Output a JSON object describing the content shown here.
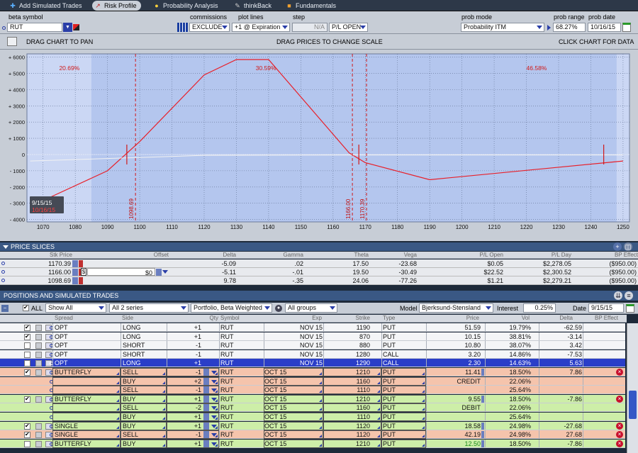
{
  "tabs": [
    {
      "label": "Add Simulated Trades",
      "icon": "plus-icon"
    },
    {
      "label": "Risk Profile",
      "icon": "chart-icon"
    },
    {
      "label": "Probability Analysis",
      "icon": "bulb-icon"
    },
    {
      "label": "thinkBack",
      "icon": "thinkback-icon"
    },
    {
      "label": "Fundamentals",
      "icon": "fundamentals-icon"
    }
  ],
  "controls": {
    "beta_symbol_label": "beta symbol",
    "symbol": "RUT",
    "commissions_label": "commissions",
    "commissions_value": "EXCLUDE",
    "plot_lines_label": "plot lines",
    "plot_lines_value": "+1 @ Expiration",
    "step_label": "step",
    "step_value": "N/A",
    "pl_mode": "P/L OPEN",
    "prob_mode_label": "prob mode",
    "prob_mode_value": "Probability ITM",
    "prob_range_label": "prob range",
    "prob_range_value": "68.27%",
    "prob_date_label": "prob date",
    "prob_date_value": "10/16/15"
  },
  "hints": {
    "pan": "DRAG CHART TO PAN",
    "scale": "DRAG PRICES TO CHANGE SCALE",
    "data": "CLICK CHART FOR DATA"
  },
  "chart_data": {
    "type": "line",
    "title": "",
    "xlabel": "",
    "ylabel": "",
    "xlim": [
      1065,
      1252
    ],
    "ylim": [
      -4150,
      6200
    ],
    "x_ticks": [
      "1070",
      "1080",
      "1090",
      "1100",
      "1110",
      "1120",
      "1130",
      "1140",
      "1150",
      "1160",
      "1170",
      "1180",
      "1190",
      "1200",
      "1210",
      "1220",
      "1230",
      "1240",
      "1250"
    ],
    "y_ticks": [
      "+ 6000",
      "+ 5000",
      "+ 4000",
      "+ 3000",
      "+ 2000",
      "+ 1000",
      "0",
      "- 1000",
      "- 2000",
      "- 3000",
      "- 4000"
    ],
    "series": [
      {
        "color": "#e8202a",
        "x": [
          1066,
          1090,
          1100,
          1120,
          1130,
          1140,
          1165,
          1170,
          1190,
          1250
        ],
        "y": [
          -3200,
          -1000,
          800,
          4900,
          5850,
          5850,
          100,
          -500,
          -1550,
          -400
        ]
      },
      {
        "color": "#f2f2f2",
        "x": [
          1066,
          1120,
          1170,
          1250
        ],
        "y": [
          -400,
          -50,
          -30,
          -30
        ]
      }
    ],
    "vlines": [
      {
        "x": 1098.69,
        "label": "1098.69"
      },
      {
        "x": 1166.0,
        "label": "1166.00"
      },
      {
        "x": 1170.39,
        "label": "1170.39"
      }
    ],
    "prob_labels": [
      {
        "x": 1075,
        "label": "20.69%"
      },
      {
        "x": 1136,
        "label": "30.59%"
      },
      {
        "x": 1220,
        "label": "46.58%"
      }
    ],
    "date_marker": {
      "date": "9/15/15",
      "date2": "10/16/15"
    },
    "background_color": "#b4c6ee",
    "band_color": "#d4def6"
  },
  "price_slices": {
    "title": "PRICE SLICES",
    "headers": [
      "Stk Price",
      "Offset",
      "Delta",
      "Gamma",
      "Theta",
      "Vega",
      "P/L Open",
      "P/L Day",
      "BP Effect"
    ],
    "rows": [
      {
        "price": "1170.39",
        "offset": "",
        "delta": "-5.09",
        "gamma": ".02",
        "theta": "17.50",
        "vega": "-23.68",
        "pl_open": "$0.05",
        "pl_day": "$2,278.05",
        "bp": "($950.00)"
      },
      {
        "price": "1166.00",
        "offset": "$0",
        "delta": "-5.11",
        "gamma": "-.01",
        "theta": "19.50",
        "vega": "-30.49",
        "pl_open": "$22.52",
        "pl_day": "$2,300.52",
        "bp": "($950.00)"
      },
      {
        "price": "1098.69",
        "offset": "",
        "delta": "9.78",
        "gamma": "-.35",
        "theta": "24.06",
        "vega": "-77.26",
        "pl_open": "$1.21",
        "pl_day": "$2,279.21",
        "bp": "($950.00)"
      }
    ]
  },
  "positions": {
    "title": "POSITIONS AND SIMULATED TRADES",
    "all_label": "ALL",
    "filter": "Show All",
    "series_filter": "All 2 series",
    "portfolio": "Portfolio, Beta Weighted",
    "groups": "All groups",
    "model_label": "Model",
    "model": "Bjerksund-Stensland",
    "interest_label": "Interest",
    "interest": "0.25%",
    "date_label": "Date",
    "date": "9/15/15",
    "headers": [
      "Spread",
      "Side",
      "Qty",
      "Symbol",
      "Exp",
      "Strike",
      "Type",
      "Price",
      "Vol",
      "Delta",
      "BP Effect"
    ],
    "rows": [
      {
        "k": "o",
        "on": true,
        "spread": "OPT",
        "side": "LONG",
        "qty": "+1",
        "sym": "RUT",
        "exp": "NOV 15",
        "strike": "1190",
        "type": "PUT",
        "price": "51.59",
        "vol": "19.79%",
        "delta": "-62.59"
      },
      {
        "k": "o",
        "on": true,
        "spread": "OPT",
        "side": "LONG",
        "qty": "+1",
        "sym": "RUT",
        "exp": "NOV 15",
        "strike": "870",
        "type": "PUT",
        "price": "10.15",
        "vol": "38.81%",
        "delta": "-3.14"
      },
      {
        "k": "o",
        "on": false,
        "spread": "OPT",
        "side": "SHORT",
        "qty": "-1",
        "sym": "RUT",
        "exp": "NOV 15",
        "strike": "880",
        "type": "PUT",
        "price": "10.80",
        "vol": "38.07%",
        "delta": "3.42"
      },
      {
        "k": "o",
        "on": false,
        "spread": "OPT",
        "side": "SHORT",
        "qty": "-1",
        "sym": "RUT",
        "exp": "NOV 15",
        "strike": "1280",
        "type": "CALL",
        "price": "3.20",
        "vol": "14.86%",
        "delta": "-7.53"
      },
      {
        "k": "s",
        "on": false,
        "spread": "OPT",
        "side": "LONG",
        "qty": "+1",
        "sym": "RUT",
        "exp": "NOV 15",
        "strike": "1290",
        "type": "CALL",
        "price": "2.30",
        "vol": "14.63%",
        "delta": "5.63"
      },
      {
        "k": "r",
        "on": true,
        "spread": "BUTTERFLY",
        "side": "SELL",
        "qty": "-1",
        "sym": "RUT",
        "exp": "OCT 15",
        "strike": "1210",
        "type": "PUT",
        "price": "11.41",
        "vol": "18.50%",
        "delta": "7.86",
        "del": true
      },
      {
        "k": "r",
        "on": null,
        "spread": "",
        "side": "BUY",
        "qty": "+2",
        "sym": "RUT",
        "exp": "OCT 15",
        "strike": "1160",
        "type": "PUT",
        "price": "CREDIT",
        "vol": "22.06%",
        "delta": ""
      },
      {
        "k": "r",
        "on": null,
        "spread": "",
        "side": "SELL",
        "qty": "-1",
        "sym": "RUT",
        "exp": "OCT 15",
        "strike": "1110",
        "type": "PUT",
        "price": "",
        "vol": "25.64%",
        "delta": ""
      },
      {
        "k": "g",
        "on": true,
        "spread": "BUTTERFLY",
        "side": "BUY",
        "qty": "+1",
        "sym": "RUT",
        "exp": "OCT 15",
        "strike": "1210",
        "type": "PUT",
        "price": "9.55",
        "vol": "18.50%",
        "delta": "-7.86",
        "del": true
      },
      {
        "k": "g",
        "on": null,
        "spread": "",
        "side": "SELL",
        "qty": "-2",
        "sym": "RUT",
        "exp": "OCT 15",
        "strike": "1160",
        "type": "PUT",
        "price": "DEBIT",
        "vol": "22.06%",
        "delta": ""
      },
      {
        "k": "g",
        "on": null,
        "spread": "",
        "side": "BUY",
        "qty": "+1",
        "sym": "RUT",
        "exp": "OCT 15",
        "strike": "1110",
        "type": "PUT",
        "price": "",
        "vol": "25.64%",
        "delta": ""
      },
      {
        "k": "g",
        "on": true,
        "spread": "SINGLE",
        "side": "BUY",
        "qty": "+1",
        "sym": "RUT",
        "exp": "OCT 15",
        "strike": "1120",
        "type": "PUT",
        "price": "18.58",
        "vol": "24.98%",
        "delta": "-27.68",
        "del": true
      },
      {
        "k": "r",
        "on": true,
        "spread": "SINGLE",
        "side": "SELL",
        "qty": "-1",
        "sym": "RUT",
        "exp": "OCT 15",
        "strike": "1120",
        "type": "PUT",
        "price": "42.19",
        "vol": "24.98%",
        "delta": "27.68",
        "del": true
      },
      {
        "k": "g",
        "on": false,
        "spread": "BUTTERFLY",
        "side": "BUY",
        "qty": "+1",
        "sym": "RUT",
        "exp": "OCT 15",
        "strike": "1210",
        "type": "PUT",
        "price": "12.50",
        "vol": "18.50%",
        "delta": "-7.86",
        "del": true
      }
    ]
  },
  "colors": {
    "accent": "#3a5884",
    "selected": "#2a3ec8",
    "sell_row": "#f5c4ac",
    "buy_row": "#cdeea8",
    "curve": "#e8202a"
  }
}
